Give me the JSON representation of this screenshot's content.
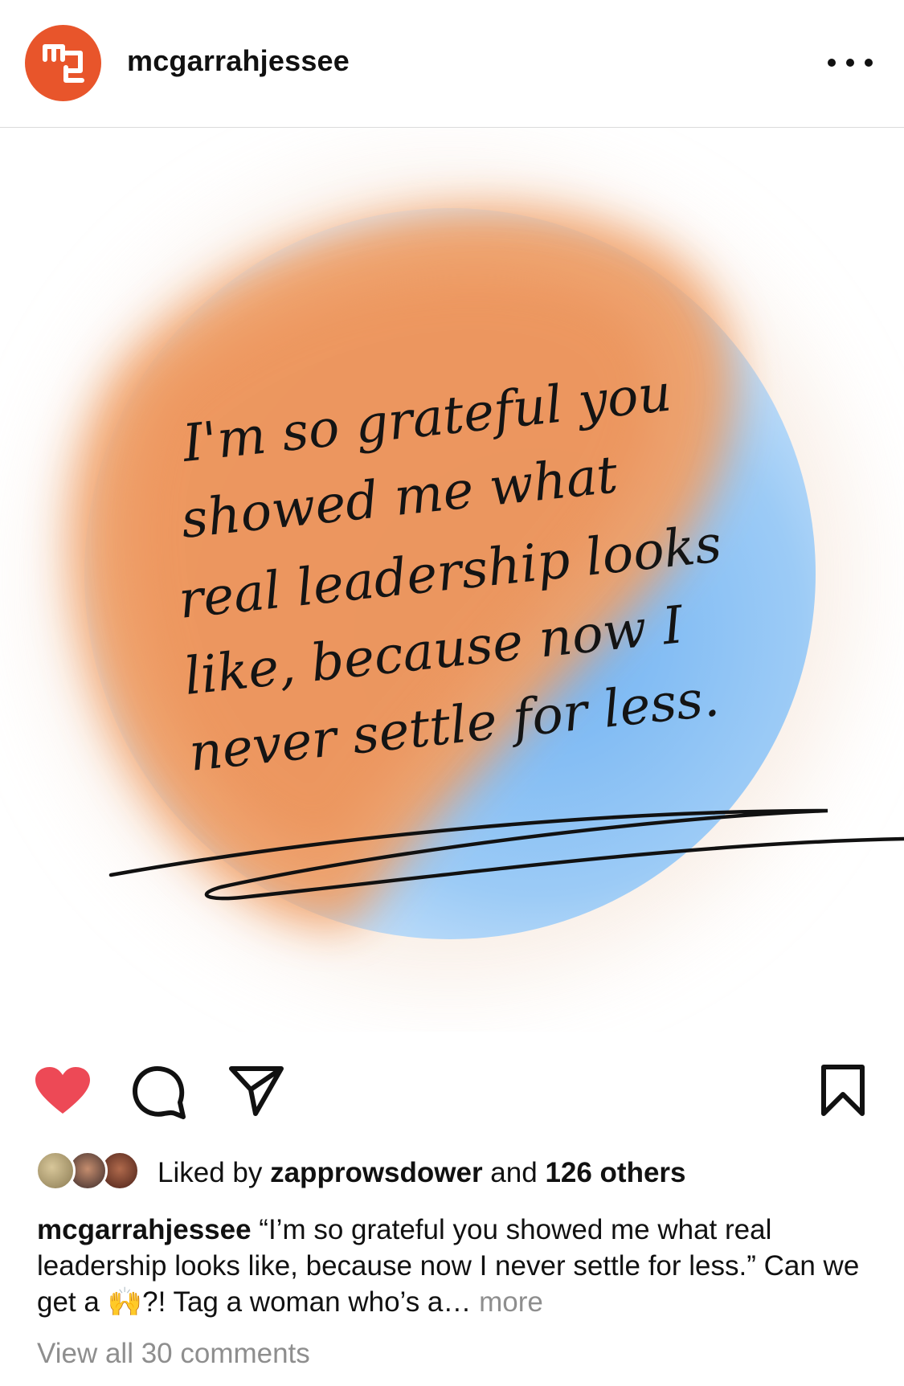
{
  "header": {
    "username": "mcgarrahjessee",
    "avatar_icon": "mcgarrah-jessee-logo",
    "more_icon": "more-options-icon"
  },
  "post": {
    "quote_lines": [
      "I'm so grateful you",
      "showed me what",
      "real leadership looks",
      "like, because now I",
      "never settle for less."
    ],
    "colors": {
      "orange": "#f0a26b",
      "blue": "#8cc2f4",
      "brand": "#e8552b",
      "like_red": "#ed4956"
    }
  },
  "actions": {
    "like_icon": "heart-icon",
    "comment_icon": "comment-icon",
    "share_icon": "share-icon",
    "save_icon": "bookmark-icon",
    "liked": true
  },
  "likes": {
    "prefix": "Liked by ",
    "user": "zapprowsdower",
    "middle": " and ",
    "others": "126 others"
  },
  "caption": {
    "username": "mcgarrahjessee",
    "text_before_emoji": " “I’m so grateful you showed me what real leadership looks like, because now I never settle for less.” Can we get a ",
    "emoji": "🙌",
    "text_after_emoji": "?! Tag a woman who’s a… ",
    "more": "more"
  },
  "comments": {
    "view_all": "View all 30 comments"
  }
}
